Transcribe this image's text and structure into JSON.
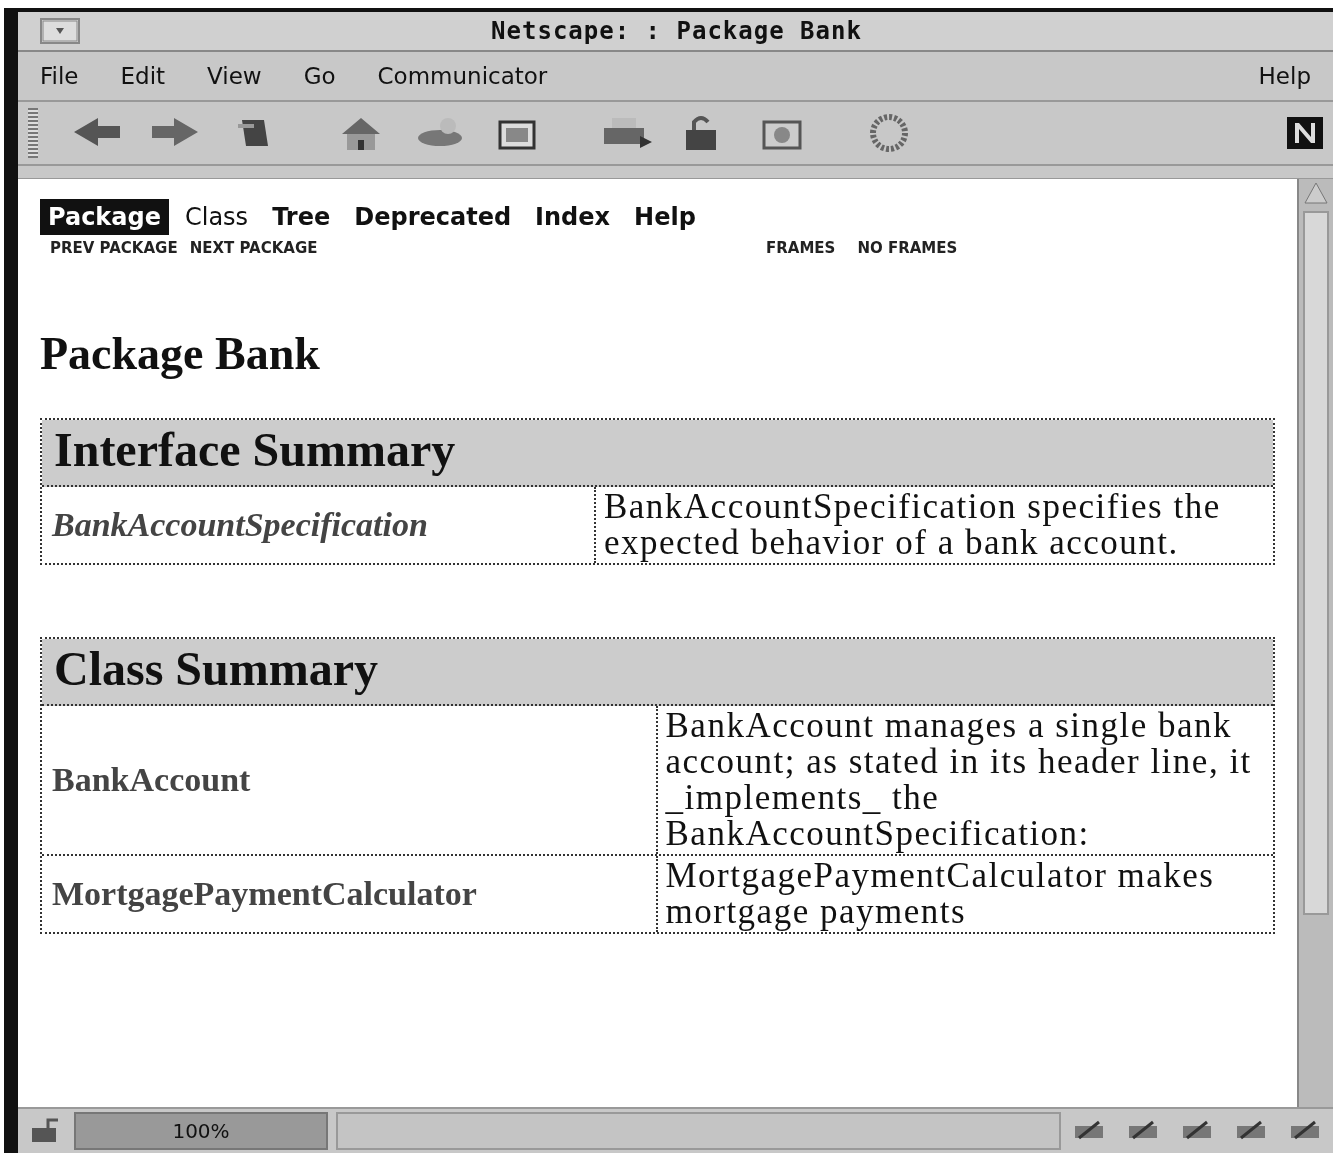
{
  "window": {
    "title": "Netscape: : Package Bank"
  },
  "menu": [
    {
      "label": "File"
    },
    {
      "label": "Edit"
    },
    {
      "label": "View"
    },
    {
      "label": "Go"
    },
    {
      "label": "Communicator"
    },
    {
      "label": "Help",
      "kind": "right"
    }
  ],
  "nav": {
    "tabs": [
      {
        "label": "Package",
        "selected": true,
        "kind": "link"
      },
      {
        "label": "Class",
        "selected": false,
        "kind": "inactive"
      },
      {
        "label": "Tree",
        "selected": false,
        "kind": "link"
      },
      {
        "label": "Deprecated",
        "selected": false,
        "kind": "link"
      },
      {
        "label": "Index",
        "selected": false,
        "kind": "link"
      },
      {
        "label": "Help",
        "selected": false,
        "kind": "link"
      }
    ],
    "left_links": [
      "PREV PACKAGE",
      "NEXT PACKAGE"
    ],
    "right_links": [
      "FRAMES",
      "NO FRAMES"
    ]
  },
  "heading": "Package Bank",
  "tables": [
    {
      "title": "Interface Summary",
      "rows": [
        {
          "name": "BankAccountSpecification",
          "italic": true,
          "description": "BankAccountSpecification specifies the expected behavior of a bank account."
        }
      ]
    },
    {
      "title": "Class Summary",
      "rows": [
        {
          "name": "BankAccount",
          "italic": false,
          "description": "BankAccount manages a single bank account; as stated in its header line, it _implements_ the BankAccountSpecification:"
        },
        {
          "name": "MortgagePaymentCalculator",
          "italic": false,
          "description": "MortgagePaymentCalculator makes mortgage payments"
        }
      ]
    }
  ],
  "status_bar": {
    "progress": "100%"
  }
}
